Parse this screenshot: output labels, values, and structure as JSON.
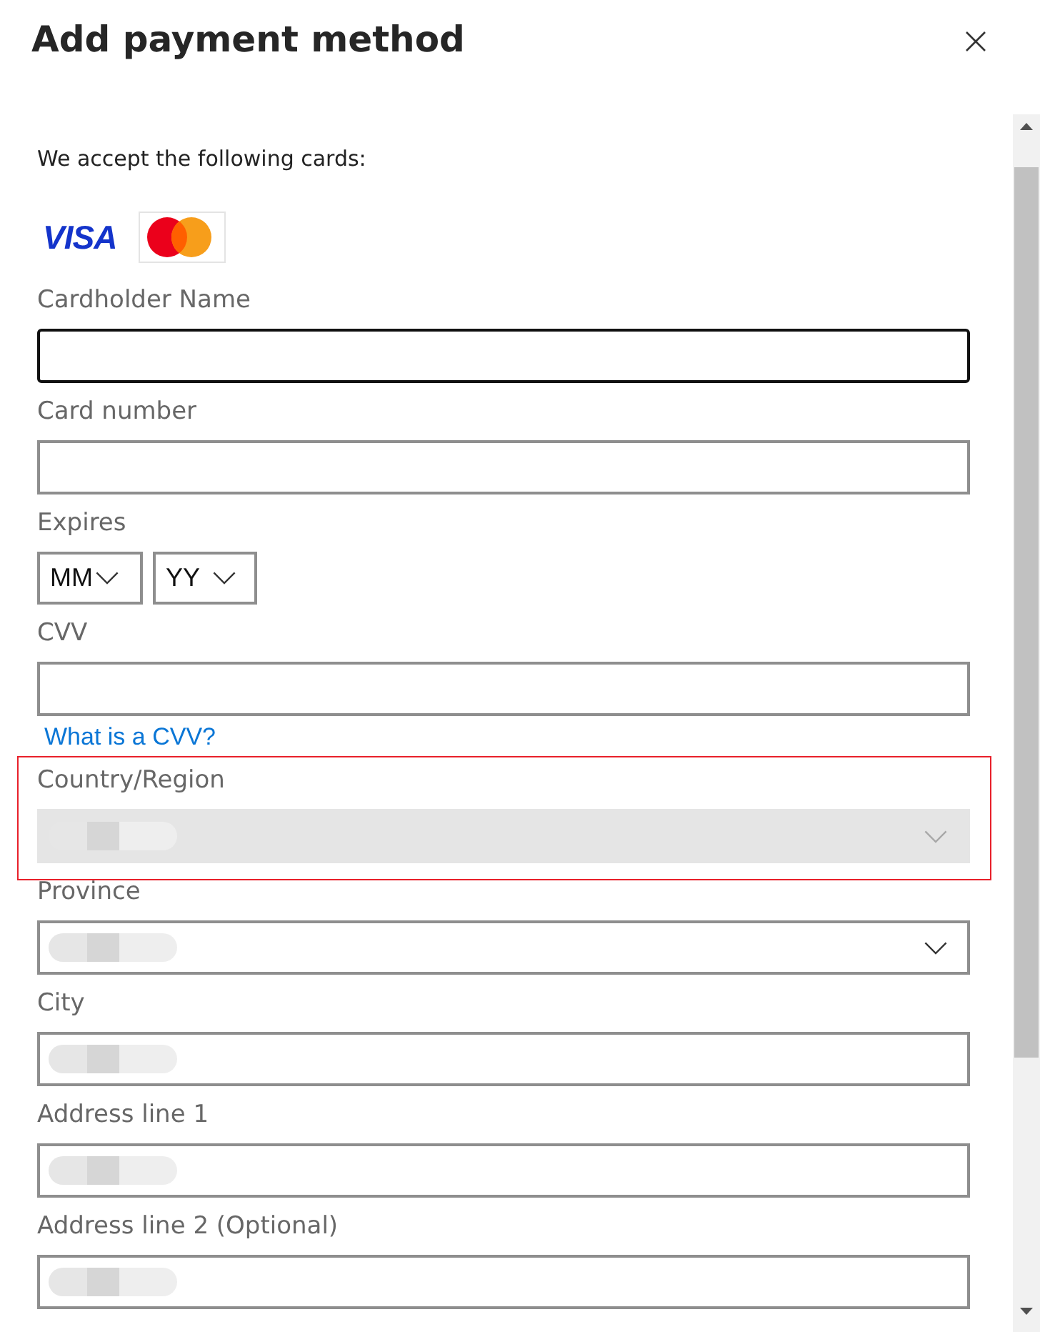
{
  "dialog": {
    "title": "Add payment method"
  },
  "intro": "We accept the following cards:",
  "cards": [
    {
      "kind": "visa",
      "label": "VISA"
    },
    {
      "kind": "mastercard"
    }
  ],
  "fields": [
    {
      "kind": "text",
      "label": "Cardholder Name",
      "focused": true,
      "highlighted": false,
      "redacted": false
    },
    {
      "kind": "text",
      "label": "Card number",
      "focused": false,
      "highlighted": false,
      "redacted": false
    },
    {
      "kind": "expiry",
      "label": "Expires",
      "highlighted": false,
      "selects": [
        {
          "kind": "month",
          "value": "MM"
        },
        {
          "kind": "year",
          "value": "YY"
        }
      ]
    },
    {
      "kind": "text",
      "label": "CVV",
      "focused": false,
      "highlighted": false,
      "redacted": false,
      "link": "What is a CVV?"
    },
    {
      "kind": "select",
      "label": "Country/Region",
      "disabled": true,
      "highlighted": true,
      "redacted": true
    },
    {
      "kind": "select",
      "label": "Province",
      "disabled": false,
      "highlighted": false,
      "redacted": true
    },
    {
      "kind": "text",
      "label": "City",
      "focused": false,
      "highlighted": false,
      "redacted": true
    },
    {
      "kind": "text",
      "label": "Address line 1",
      "focused": false,
      "highlighted": false,
      "redacted": true
    },
    {
      "kind": "text",
      "label": "Address line 2 (Optional)",
      "focused": false,
      "highlighted": false,
      "redacted": true
    }
  ]
}
